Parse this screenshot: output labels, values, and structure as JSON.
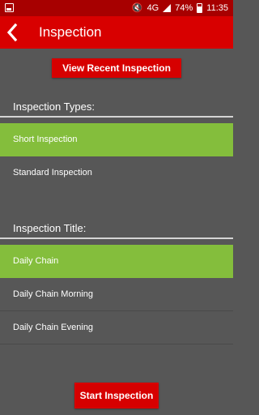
{
  "status_bar": {
    "battery": "74%",
    "time": "11:35",
    "network": "4G"
  },
  "header": {
    "title": "Inspection"
  },
  "buttons": {
    "view_recent": "View Recent Inspection",
    "start": "Start Inspection"
  },
  "inspection_types": {
    "label": "Inspection Types:",
    "items": [
      {
        "label": "Short Inspection",
        "selected": true
      },
      {
        "label": "Standard Inspection",
        "selected": false
      }
    ]
  },
  "inspection_titles": {
    "label": "Inspection Title:",
    "items": [
      {
        "label": "Daily Chain",
        "selected": true
      },
      {
        "label": "Daily Chain Morning",
        "selected": false
      },
      {
        "label": "Daily Chain Evening",
        "selected": false
      }
    ]
  },
  "colors": {
    "header": "#d80000",
    "status_bar": "#a70000",
    "background": "#575757",
    "selected": "#84be3c",
    "button": "#d60000"
  }
}
